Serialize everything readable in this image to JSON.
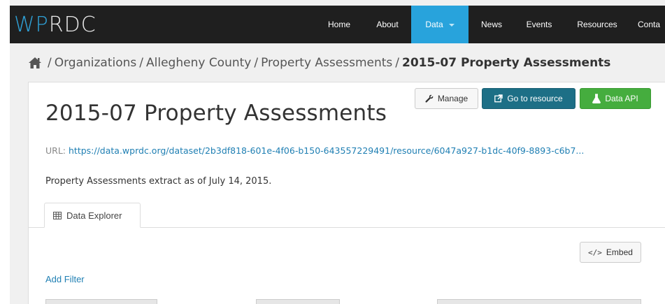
{
  "logo": {
    "part1": "WP",
    "part2": "RDC"
  },
  "nav": {
    "items": [
      {
        "label": "Home"
      },
      {
        "label": "About"
      },
      {
        "label": "Data"
      },
      {
        "label": "News"
      },
      {
        "label": "Events"
      },
      {
        "label": "Resources"
      },
      {
        "label": "Conta"
      }
    ],
    "active_color": "#28a3dc"
  },
  "breadcrumb": {
    "items": [
      "Organizations",
      "Allegheny County",
      "Property Assessments"
    ],
    "current": "2015-07 Property Assessments",
    "separator": "/"
  },
  "actions": {
    "manage": "Manage",
    "go_to_resource": "Go to resource",
    "data_api": "Data API"
  },
  "resource": {
    "title": "2015-07 Property Assessments",
    "url_label": "URL:",
    "url": "https://data.wprdc.org/dataset/2b3df818-601e-4f06-b150-643557229491/resource/6047a927-b1dc-40f9-8893-c6b7...",
    "description": "Property Assessments extract as of July 14, 2015."
  },
  "tabs": {
    "data_explorer": "Data Explorer"
  },
  "explorer": {
    "embed": "Embed",
    "add_filter": "Add Filter"
  },
  "colors": {
    "topbar": "#1f1f1f",
    "primary_button": "#1d6f86",
    "success_button": "#45ad3e",
    "link": "#1f7fb3"
  }
}
